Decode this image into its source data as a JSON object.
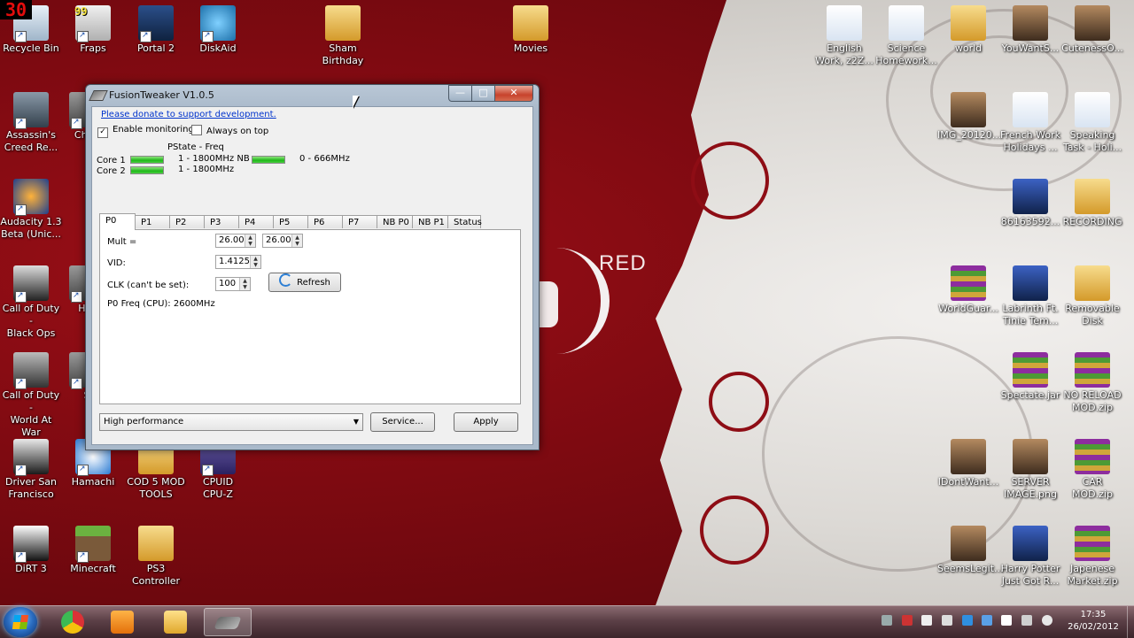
{
  "overlay": {
    "fps": "30",
    "fps_small": "99"
  },
  "colors": {
    "accent": "#1fb81a",
    "link": "#0033cc",
    "wall_red": "#7e0a11"
  },
  "wallpaper": {
    "text": "RED"
  },
  "desktop_icons_left": [
    {
      "label": "Recycle Bin",
      "icon": "recycle-bin-icon"
    },
    {
      "label": "Fraps",
      "icon": "fraps-icon"
    },
    {
      "label": "Portal 2",
      "icon": "portal2-icon"
    },
    {
      "label": "DiskAid",
      "icon": "diskaid-icon"
    },
    {
      "label": "Sham\nBirthday",
      "icon": "folder-icon"
    },
    {
      "label": "Movies",
      "icon": "folder-icon"
    },
    {
      "label": "Assassin's\nCreed Re...",
      "icon": "assassins-creed-icon"
    },
    {
      "label": "Chea",
      "icon": "app-icon"
    },
    {
      "label": "Audacity 1.3\nBeta (Unic...",
      "icon": "audacity-icon"
    },
    {
      "label": "Call of Duty -\nBlack Ops",
      "icon": "black-ops-icon"
    },
    {
      "label": "Har",
      "icon": "app-icon"
    },
    {
      "label": "Call of Duty -\nWorld At War",
      "icon": "world-at-war-icon"
    },
    {
      "label": "S",
      "icon": "app-icon"
    },
    {
      "label": "Driver San\nFrancisco",
      "icon": "driver-icon"
    },
    {
      "label": "Hamachi",
      "icon": "hamachi-icon"
    },
    {
      "label": "COD 5 MOD\nTOOLS",
      "icon": "folder-icon"
    },
    {
      "label": "CPUID\nCPU-Z",
      "icon": "cpuz-icon"
    },
    {
      "label": "DiRT 3",
      "icon": "dirt3-icon"
    },
    {
      "label": "Minecraft",
      "icon": "minecraft-icon"
    },
    {
      "label": "PS3\nController",
      "icon": "folder-icon"
    }
  ],
  "desktop_icons_right": [
    {
      "label": "English\nWork, z2Z...",
      "icon": "word-doc-icon"
    },
    {
      "label": "Science\nHomework...",
      "icon": "word-doc-icon"
    },
    {
      "label": "world",
      "icon": "folder-icon"
    },
    {
      "label": "YouWantS...",
      "icon": "image-icon"
    },
    {
      "label": "CutenessO...",
      "icon": "image-icon"
    },
    {
      "label": "IMG_20120...",
      "icon": "image-icon"
    },
    {
      "label": "French Work\nHolidays ...",
      "icon": "word-doc-icon"
    },
    {
      "label": "Speaking\nTask - Holi...",
      "icon": "word-doc-icon"
    },
    {
      "label": "86163592...",
      "icon": "video-icon"
    },
    {
      "label": "RECORDING",
      "icon": "folder-icon"
    },
    {
      "label": "WorldGuar...",
      "icon": "winrar-icon"
    },
    {
      "label": "Labrinth Ft.\nTinie Tem...",
      "icon": "video-icon"
    },
    {
      "label": "Removable\nDisk",
      "icon": "folder-icon"
    },
    {
      "label": "Spectate.jar",
      "icon": "winrar-icon"
    },
    {
      "label": "NO RELOAD\nMOD.zip",
      "icon": "winrar-icon"
    },
    {
      "label": "IDontWant...",
      "icon": "image-icon"
    },
    {
      "label": "SERVER\nIMAGE.png",
      "icon": "image-icon"
    },
    {
      "label": "CAR\nMOD.zip",
      "icon": "winrar-icon"
    },
    {
      "label": "SeemsLegit...",
      "icon": "image-icon"
    },
    {
      "label": "Harry Potter\nJust Got R...",
      "icon": "video-icon"
    },
    {
      "label": "Japenese\nMarket.zip",
      "icon": "winrar-icon"
    }
  ],
  "window": {
    "title": "FusionTweaker V1.0.5",
    "min": "—",
    "max": "□",
    "close": "✕",
    "donate_link": "Please donate to support development.",
    "enable_monitoring": {
      "label": "Enable monitoring",
      "checked": true
    },
    "always_on_top": {
      "label": "Always on top",
      "checked": false
    },
    "pstate_header": "PState - Freq",
    "core1": {
      "label": "Core 1",
      "bar": 1.0,
      "freq": "1 - 1800MHz NB"
    },
    "core2": {
      "label": "Core 2",
      "bar": 1.0,
      "freq": "1 - 1800MHz"
    },
    "nb": {
      "bar": 1.0,
      "freq": "0 - 666MHz"
    },
    "tabs": [
      "P0",
      "P1",
      "P2",
      "P3",
      "P4",
      "P5",
      "P6",
      "P7",
      "NB P0",
      "NB P1",
      "Status"
    ],
    "active_tab": 0,
    "mult_label": "Mult =",
    "mult_a": "26.00",
    "mult_b": "26.00",
    "vid_label": "VID:",
    "vid": "1.4125",
    "clk_label": "CLK (can't be set):",
    "clk": "100",
    "refresh": "Refresh",
    "freq_text": "P0 Freq (CPU): 2600MHz",
    "power_plan": "High performance",
    "service": "Service...",
    "apply": "Apply"
  },
  "taskbar": {
    "pinned": [
      {
        "name": "chrome",
        "icon": "chrome-icon"
      },
      {
        "name": "media-player",
        "icon": "media-player-icon"
      },
      {
        "name": "explorer",
        "icon": "explorer-icon"
      },
      {
        "name": "fusiontweaker",
        "icon": "fusiontweaker-icon"
      }
    ],
    "time": "17:35",
    "date": "26/02/2012"
  }
}
